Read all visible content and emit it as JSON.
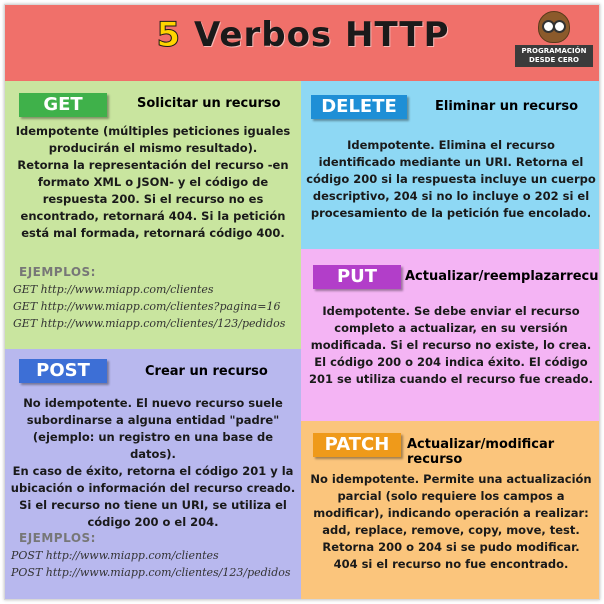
{
  "header": {
    "title_number": "5",
    "title_text": "Verbos HTTP",
    "logo_text": "PROGRAMACIÓN DESDE CERO"
  },
  "colors": {
    "header_bg": "#f0706a",
    "get_bg": "#c9e59f",
    "post_bg": "#b8b8ee",
    "delete_bg": "#8ed8f4",
    "put_bg": "#f4b4f4",
    "patch_bg": "#fbc57c"
  },
  "get": {
    "verb": "GET",
    "title": "Solicitar un recurso",
    "description_lines": [
      "Idempotente (múltiples peticiones iguales",
      "producirán el mismo resultado).",
      "Retorna la representación del recurso -en",
      "formato XML o JSON- y el código de",
      "respuesta 200. Si el recurso no es",
      "encontrado, retornará 404. Si la petición",
      "está mal formada, retornará código 400."
    ],
    "examples_label": "EJEMPLOS:",
    "examples": [
      "GET http://www.miapp.com/clientes",
      "GET http://www.miapp.com/clientes?pagina=16",
      "GET http://www.miapp.com/clientes/123/pedidos"
    ]
  },
  "post": {
    "verb": "POST",
    "title": "Crear un recurso",
    "description_lines": [
      "No idempotente. El nuevo recurso suele",
      "subordinarse a alguna entidad \"padre\"",
      "(ejemplo: un registro en una base de datos).",
      "En caso de éxito, retorna el código 201 y la",
      "ubicación o información del recurso creado.",
      "Si el recurso no tiene un URI, se utiliza el",
      "código 200 o el 204."
    ],
    "examples_label": "EJEMPLOS:",
    "examples": [
      "POST http://www.miapp.com/clientes",
      "POST http://www.miapp.com/clientes/123/pedidos"
    ]
  },
  "delete": {
    "verb": "DELETE",
    "title": "Eliminar un recurso",
    "description_lines": [
      "Idempotente. Elimina el recurso",
      "identificado mediante un URI. Retorna el",
      "código 200 si la respuesta incluye un cuerpo",
      "descriptivo, 204 si no lo incluye o 202 si el",
      "procesamiento de la petición fue encolado."
    ]
  },
  "put": {
    "verb": "PUT",
    "title": "Actualizar/reemplazarrecurso",
    "description_lines": [
      "Idempotente. Se debe enviar el recurso",
      "completo a actualizar, en su versión",
      "modificada. Si el recurso no existe, lo crea.",
      "El código 200 o 204 indica éxito. El código",
      "201 se utiliza cuando el recurso fue creado."
    ]
  },
  "patch": {
    "verb": "PATCH",
    "title": "Actualizar/modificar recurso",
    "description_lines": [
      "No idempotente. Permite una actualización",
      "parcial (solo requiere los campos a",
      "modificar), indicando operación a realizar:",
      "add, replace, remove, copy, move, test.",
      "Retorna 200 o 204 si se pudo modificar.",
      "404 si el recurso no fue encontrado."
    ]
  }
}
